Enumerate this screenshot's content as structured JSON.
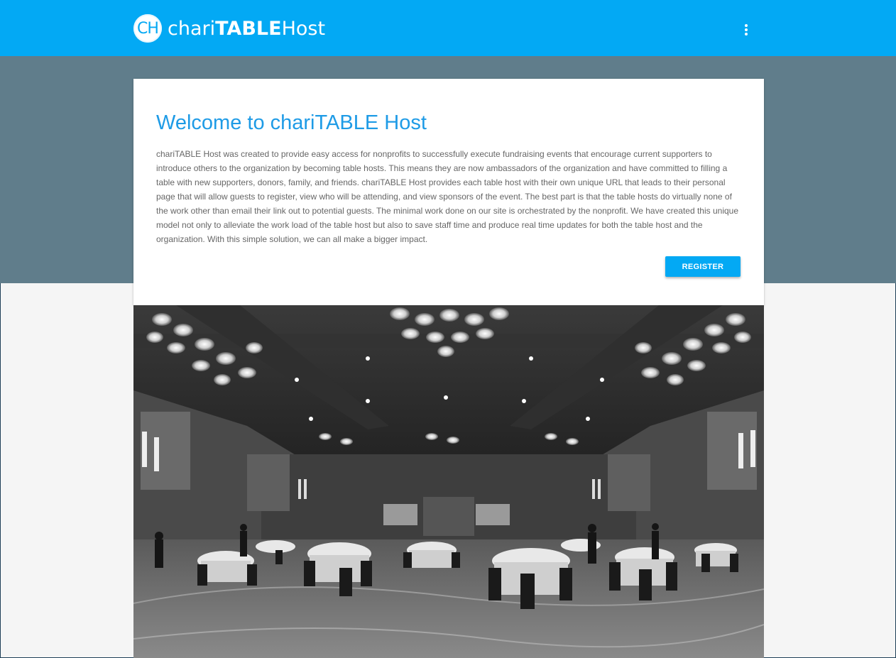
{
  "header": {
    "logo_text": "CH",
    "brand_prefix": "chari",
    "brand_bold": "TABLE",
    "brand_suffix": "Host",
    "menu_icon": "more-vert-icon"
  },
  "welcome": {
    "title": "Welcome to chariTABLE Host",
    "body": "chariTABLE Host was created to provide easy access for nonprofits to successfully execute fundraising events that encourage current supporters to introduce others to the organization by becoming table hosts. This means they are now ambassadors of the organization and have committed to filling a table with new supporters, donors, family, and friends. chariTABLE Host provides each table host with their own unique URL that leads to their personal page that will allow guests to register, view who will be attending, and view sponsors of the event. The best part is that the table hosts do virtually none of the work other than email their link out to potential guests. The minimal work done on our site is orchestrated by the nonprofit. We have created this unique model not only to alleviate the work load of the table host but also to save staff time and produce real time updates for both the table host and the organization. With this simple solution, we can all make a bigger impact.",
    "register_label": "REGISTER"
  },
  "colors": {
    "primary": "#03a9f4",
    "hero": "#607d8b",
    "title": "#1e9be6",
    "body_text": "#666666"
  }
}
